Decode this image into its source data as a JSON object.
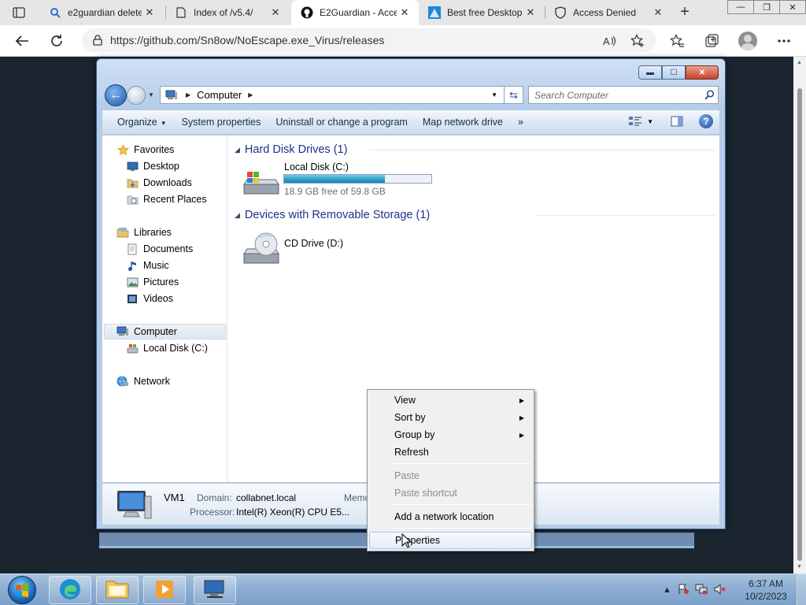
{
  "browser": {
    "tabs": [
      {
        "title": "e2guardian delete",
        "icon": "search-icon"
      },
      {
        "title": "Index of /v5.4/",
        "icon": "page-icon"
      },
      {
        "title": "E2Guardian - Acce",
        "icon": "github-icon"
      },
      {
        "title": "Best free Desktop",
        "icon": "sourceforge-icon"
      },
      {
        "title": "Access Denied",
        "icon": "shield-icon"
      }
    ],
    "active_tab": 2,
    "url": "https://github.com/Sn8ow/NoEscape.exe_Virus/releases"
  },
  "explorer": {
    "breadcrumb": "Computer",
    "search_placeholder": "Search Computer",
    "commands": {
      "organize": "Organize",
      "system_properties": "System properties",
      "uninstall": "Uninstall or change a program",
      "map_drive": "Map network drive",
      "more": "»"
    },
    "nav": {
      "favorites": "Favorites",
      "desktop": "Desktop",
      "downloads": "Downloads",
      "recent": "Recent Places",
      "libraries": "Libraries",
      "documents": "Documents",
      "music": "Music",
      "pictures": "Pictures",
      "videos": "Videos",
      "computer": "Computer",
      "local_disk": "Local Disk (C:)",
      "network": "Network"
    },
    "groups": {
      "hdd": "Hard Disk Drives (1)",
      "removable": "Devices with Removable Storage (1)"
    },
    "drives": {
      "c_label": "Local Disk (C:)",
      "c_free": "18.9 GB free of 59.8 GB",
      "c_used_fraction": 0.684,
      "d_label": "CD Drive (D:)"
    },
    "details": {
      "name": "VM1",
      "domain_label": "Domain:",
      "domain_value": "collabnet.local",
      "memory_label": "Memo",
      "processor_label": "Processor:",
      "processor_value": "Intel(R) Xeon(R) CPU E5..."
    }
  },
  "context_menu": {
    "view": "View",
    "sort_by": "Sort by",
    "group_by": "Group by",
    "refresh": "Refresh",
    "paste": "Paste",
    "paste_shortcut": "Paste shortcut",
    "add_network": "Add a network location",
    "properties": "Properties"
  },
  "taskbar": {
    "time": "6:37 AM",
    "date": "10/2/2023"
  }
}
